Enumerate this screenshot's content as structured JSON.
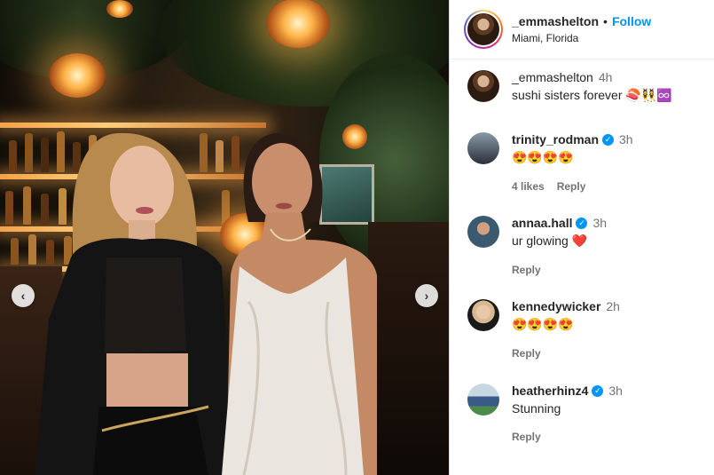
{
  "post": {
    "author": "_emmashelton",
    "location": "Miami, Florida",
    "follow_label": "Follow",
    "separator": "•"
  },
  "carousel": {
    "prev_icon": "‹",
    "next_icon": "›"
  },
  "caption": {
    "user": "_emmashelton",
    "time": "4h",
    "text": "sushi sisters forever 🍣👯‍♀️♾️"
  },
  "comments": [
    {
      "user": "trinity_rodman",
      "verified": true,
      "time": "3h",
      "text": "😍😍😍😍",
      "likes": "4 likes",
      "reply": "Reply"
    },
    {
      "user": "annaa.hall",
      "verified": true,
      "time": "3h",
      "text": "ur glowing ❤️",
      "likes": "",
      "reply": "Reply"
    },
    {
      "user": "kennedywicker",
      "verified": false,
      "time": "2h",
      "text": "😍😍😍😍",
      "likes": "",
      "reply": "Reply"
    },
    {
      "user": "heatherhinz4",
      "verified": true,
      "time": "3h",
      "text": "Stunning",
      "likes": "",
      "reply": "Reply"
    }
  ],
  "colors": {
    "follow": "#0095f6",
    "verified": "#0095f6",
    "meta": "#737373"
  }
}
